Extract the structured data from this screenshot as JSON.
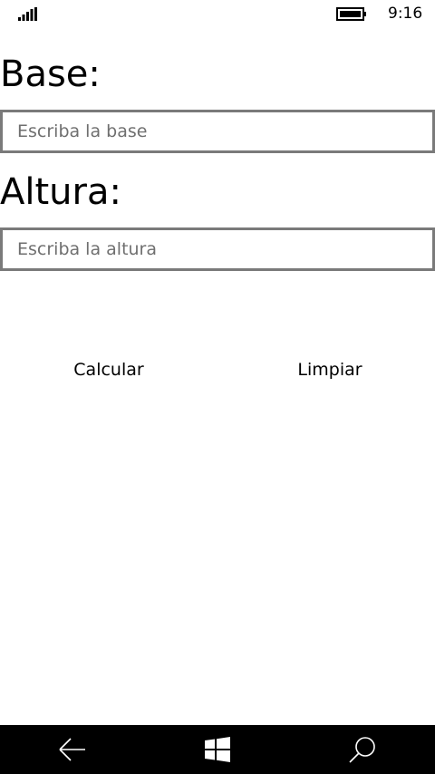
{
  "status_bar": {
    "time": "9:16",
    "signal_icon": "signal-icon",
    "battery_icon": "battery-icon"
  },
  "form": {
    "base_label": "Base:",
    "base_placeholder": "Escriba la base",
    "base_value": "",
    "altura_label": "Altura:",
    "altura_placeholder": "Escriba la altura",
    "altura_value": ""
  },
  "actions": {
    "calcular_label": "Calcular",
    "limpiar_label": "Limpiar"
  },
  "nav_bar": {
    "back_icon": "back-arrow-icon",
    "home_icon": "windows-logo-icon",
    "search_icon": "search-icon"
  },
  "colors": {
    "background": "#ffffff",
    "input_border": "#7a7a7a",
    "placeholder": "#6f6f6f",
    "nav_bar": "#000000"
  }
}
